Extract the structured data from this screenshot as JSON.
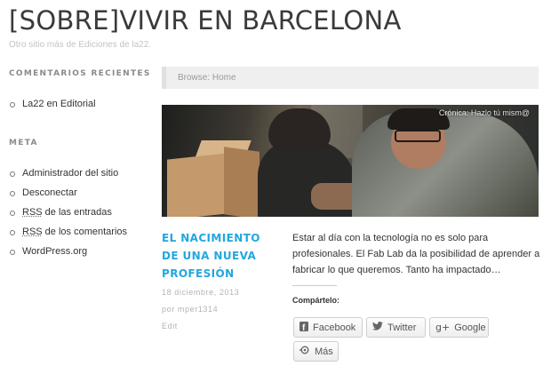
{
  "site": {
    "title": "[SOBRE]VIVIR EN BARCELONA",
    "description": "Otro sitio más de Ediciones de la22."
  },
  "sidebar": {
    "recent_comments": {
      "title": "COMENTARIOS RECIENTES",
      "items": [
        "La22 en Editorial"
      ]
    },
    "meta": {
      "title": "META",
      "items": [
        "Administrador del sitio",
        "Desconectar"
      ],
      "rss_label": "RSS",
      "rss_entries_suffix": " de las entradas",
      "rss_comments_suffix": " de los comentarios",
      "wordpress": "WordPress.org"
    }
  },
  "breadcrumb": "Browse: Home",
  "post": {
    "category": "Crónica: Hazlo tú mism@",
    "title": "EL NACIMIENTO DE UNA NUEVA PROFESIÓN",
    "date": "18 diciembre, 2013",
    "author": "por mper1314",
    "edit": "Edit",
    "excerpt": "Estar al día con la tecnología no es solo para profesionales. El Fab Lab da la posibilidad de aprender a fabricar lo que queremos. Tanto ha impactado…"
  },
  "share": {
    "title": "Compártelo:",
    "buttons": [
      {
        "label": "Facebook",
        "icon": "facebook-icon"
      },
      {
        "label": "Twitter",
        "icon": "twitter-icon"
      },
      {
        "label": "Google",
        "icon": "google-plus-icon"
      },
      {
        "label": "Más",
        "icon": "share-more-icon"
      }
    ]
  }
}
